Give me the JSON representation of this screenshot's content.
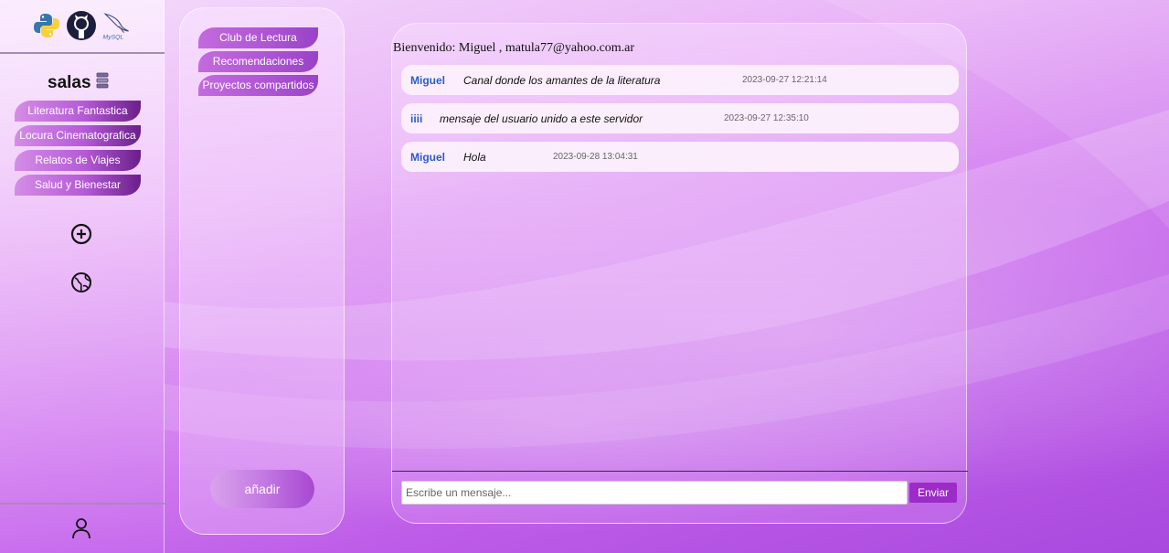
{
  "brand_logos": [
    {
      "name": "python-logo"
    },
    {
      "name": "github-logo"
    },
    {
      "name": "mysql-logo",
      "text": "MySQL"
    }
  ],
  "sidebar": {
    "title": "salas",
    "title_icon": "database-icon",
    "rooms": [
      {
        "label": "Literatura Fantastica"
      },
      {
        "label": "Locura Cinematografica"
      },
      {
        "label": "Relatos de Viajes"
      },
      {
        "label": "Salud y Bienestar"
      }
    ],
    "icons": [
      "add-circle-icon",
      "globe-icon",
      "user-icon"
    ]
  },
  "channels": {
    "items": [
      {
        "label": "Club de Lectura"
      },
      {
        "label": "Recomendaciones"
      },
      {
        "label": "Proyectos compartidos"
      }
    ],
    "add_label": "añadir"
  },
  "chat": {
    "welcome": "Bienvenido: Miguel , matula77@yahoo.com.ar",
    "messages": [
      {
        "user": "Miguel",
        "text": "Canal donde los amantes de la literatura",
        "time": "2023-09-27 12:21:14"
      },
      {
        "user": "iiii",
        "text": "mensaje del usuario unido a este servidor",
        "time": "2023-09-27 12:35:10"
      },
      {
        "user": "Miguel",
        "text": "Hola",
        "time": "2023-09-28 13:04:31"
      }
    ],
    "input_placeholder": "Escribe un mensaje...",
    "send_label": "Enviar"
  },
  "colors": {
    "accent": "#9c2bc7",
    "username": "#2d5bc6",
    "pill_dark": "#6a1f8a"
  }
}
